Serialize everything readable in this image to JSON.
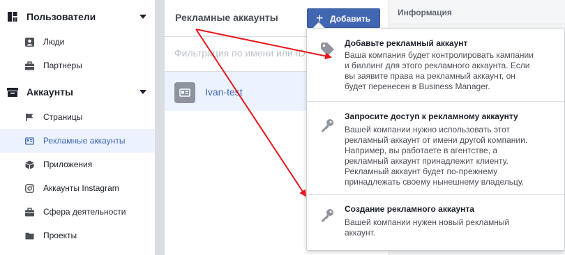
{
  "sidebar": {
    "users_header": "Пользователи",
    "users_items": [
      {
        "label": "Люди",
        "icon": "person-icon"
      },
      {
        "label": "Партнеры",
        "icon": "briefcase-icon"
      }
    ],
    "accounts_header": "Аккаунты",
    "accounts_items": [
      {
        "label": "Страницы",
        "icon": "flag-icon"
      },
      {
        "label": "Рекламные аккаунты",
        "icon": "ad-account-icon",
        "active": true
      },
      {
        "label": "Приложения",
        "icon": "cube-icon"
      },
      {
        "label": "Аккаунты Instagram",
        "icon": "instagram-icon"
      },
      {
        "label": "Сфера деятельности",
        "icon": "briefcase-icon"
      },
      {
        "label": "Проекты",
        "icon": "folder-icon"
      }
    ]
  },
  "main": {
    "title": "Рекламные аккаунты",
    "add_button": "Добавить",
    "filter_placeholder": "Фильтрация по имени или ID",
    "account_name": "Ivan-test"
  },
  "info": {
    "title": "Информация"
  },
  "dropdown": {
    "options": [
      {
        "title": "Добавьте рекламный аккаунт",
        "lines": [
          "Ваша компания будет контролировать кампании",
          "и биллинг для этого рекламного аккаунта. Если",
          "вы заявите права на рекламный аккаунт, он",
          "будет перенесен в Business Manager."
        ],
        "icon": "tag-icon"
      },
      {
        "title": "Запросите доступ к рекламному аккаунту",
        "lines": [
          "Вашей компании нужно использовать этот",
          "рекламный аккаунт от имени другой компании.",
          "Например, вы работаете в агентстве, а",
          "рекламный аккаунт принадлежит клиенту.",
          "Рекламный аккаунт будет по-прежнему",
          "принадлежать своему нынешнему владельцу."
        ],
        "icon": "key-icon"
      },
      {
        "title": "Создание рекламного аккаунта",
        "lines": [
          "Вашей компании нужен новый рекламный",
          "аккаунт."
        ],
        "icon": "key-icon"
      }
    ]
  },
  "colors": {
    "brand": "#4267b2",
    "active_bg": "#ecf3ff",
    "arrow": "#e8161b"
  }
}
